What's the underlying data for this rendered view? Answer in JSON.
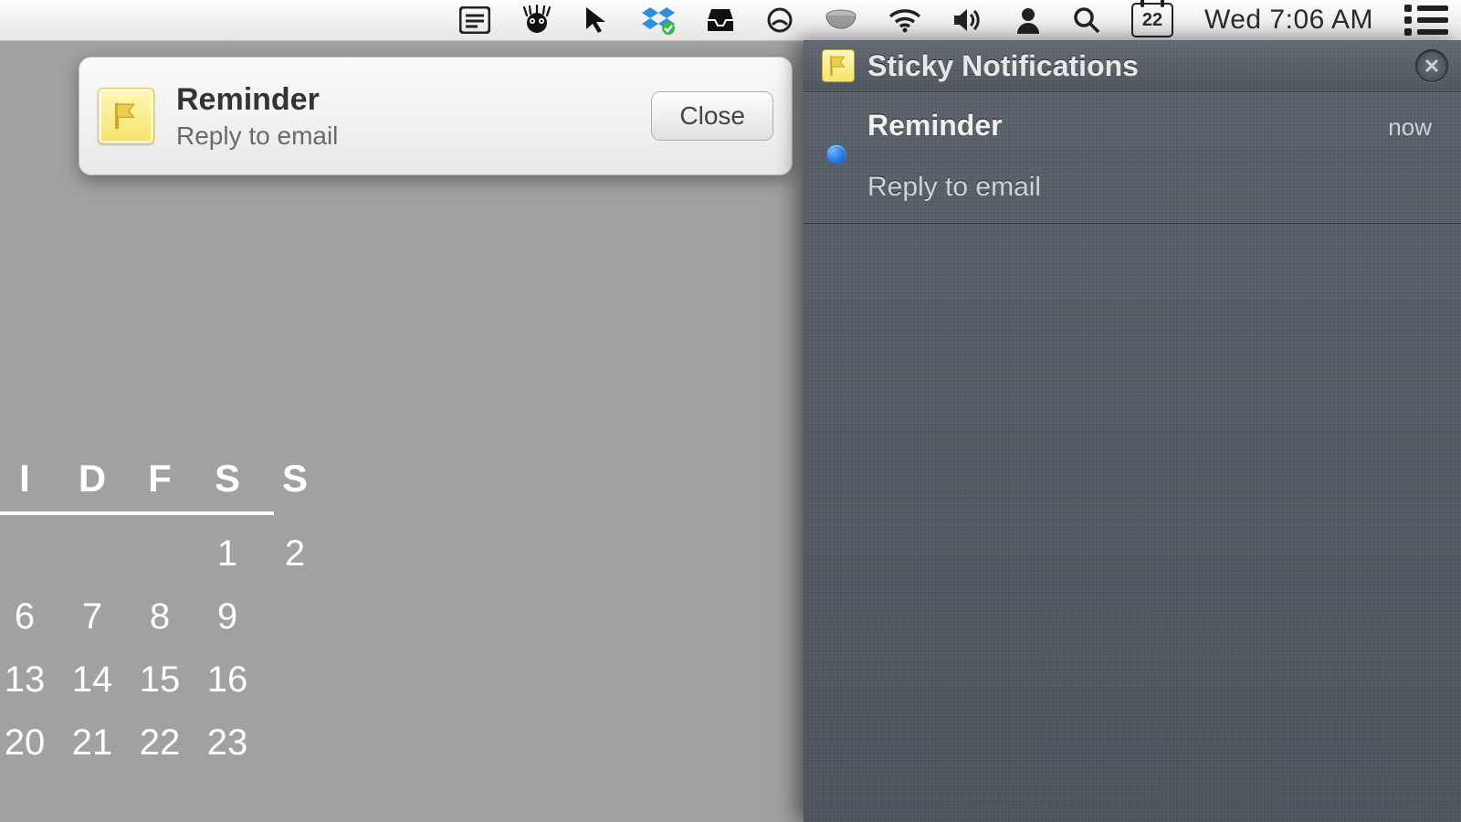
{
  "menubar": {
    "date_number": "22",
    "clock": "Wed 7:06 AM"
  },
  "banner": {
    "title": "Reminder",
    "body": "Reply to email",
    "close_label": "Close"
  },
  "notification_center": {
    "app_title": "Sticky Notifications",
    "items": [
      {
        "title": "Reminder",
        "time": "now",
        "body": "Reply to email"
      }
    ]
  },
  "calendar": {
    "day_headers": [
      "I",
      "D",
      "F",
      "S",
      "S"
    ],
    "rows": [
      [
        "",
        "",
        "",
        "1",
        "2"
      ],
      [
        "6",
        "7",
        "8",
        "9"
      ],
      [
        "13",
        "14",
        "15",
        "16"
      ],
      [
        "20",
        "21",
        "22",
        "23"
      ]
    ]
  }
}
